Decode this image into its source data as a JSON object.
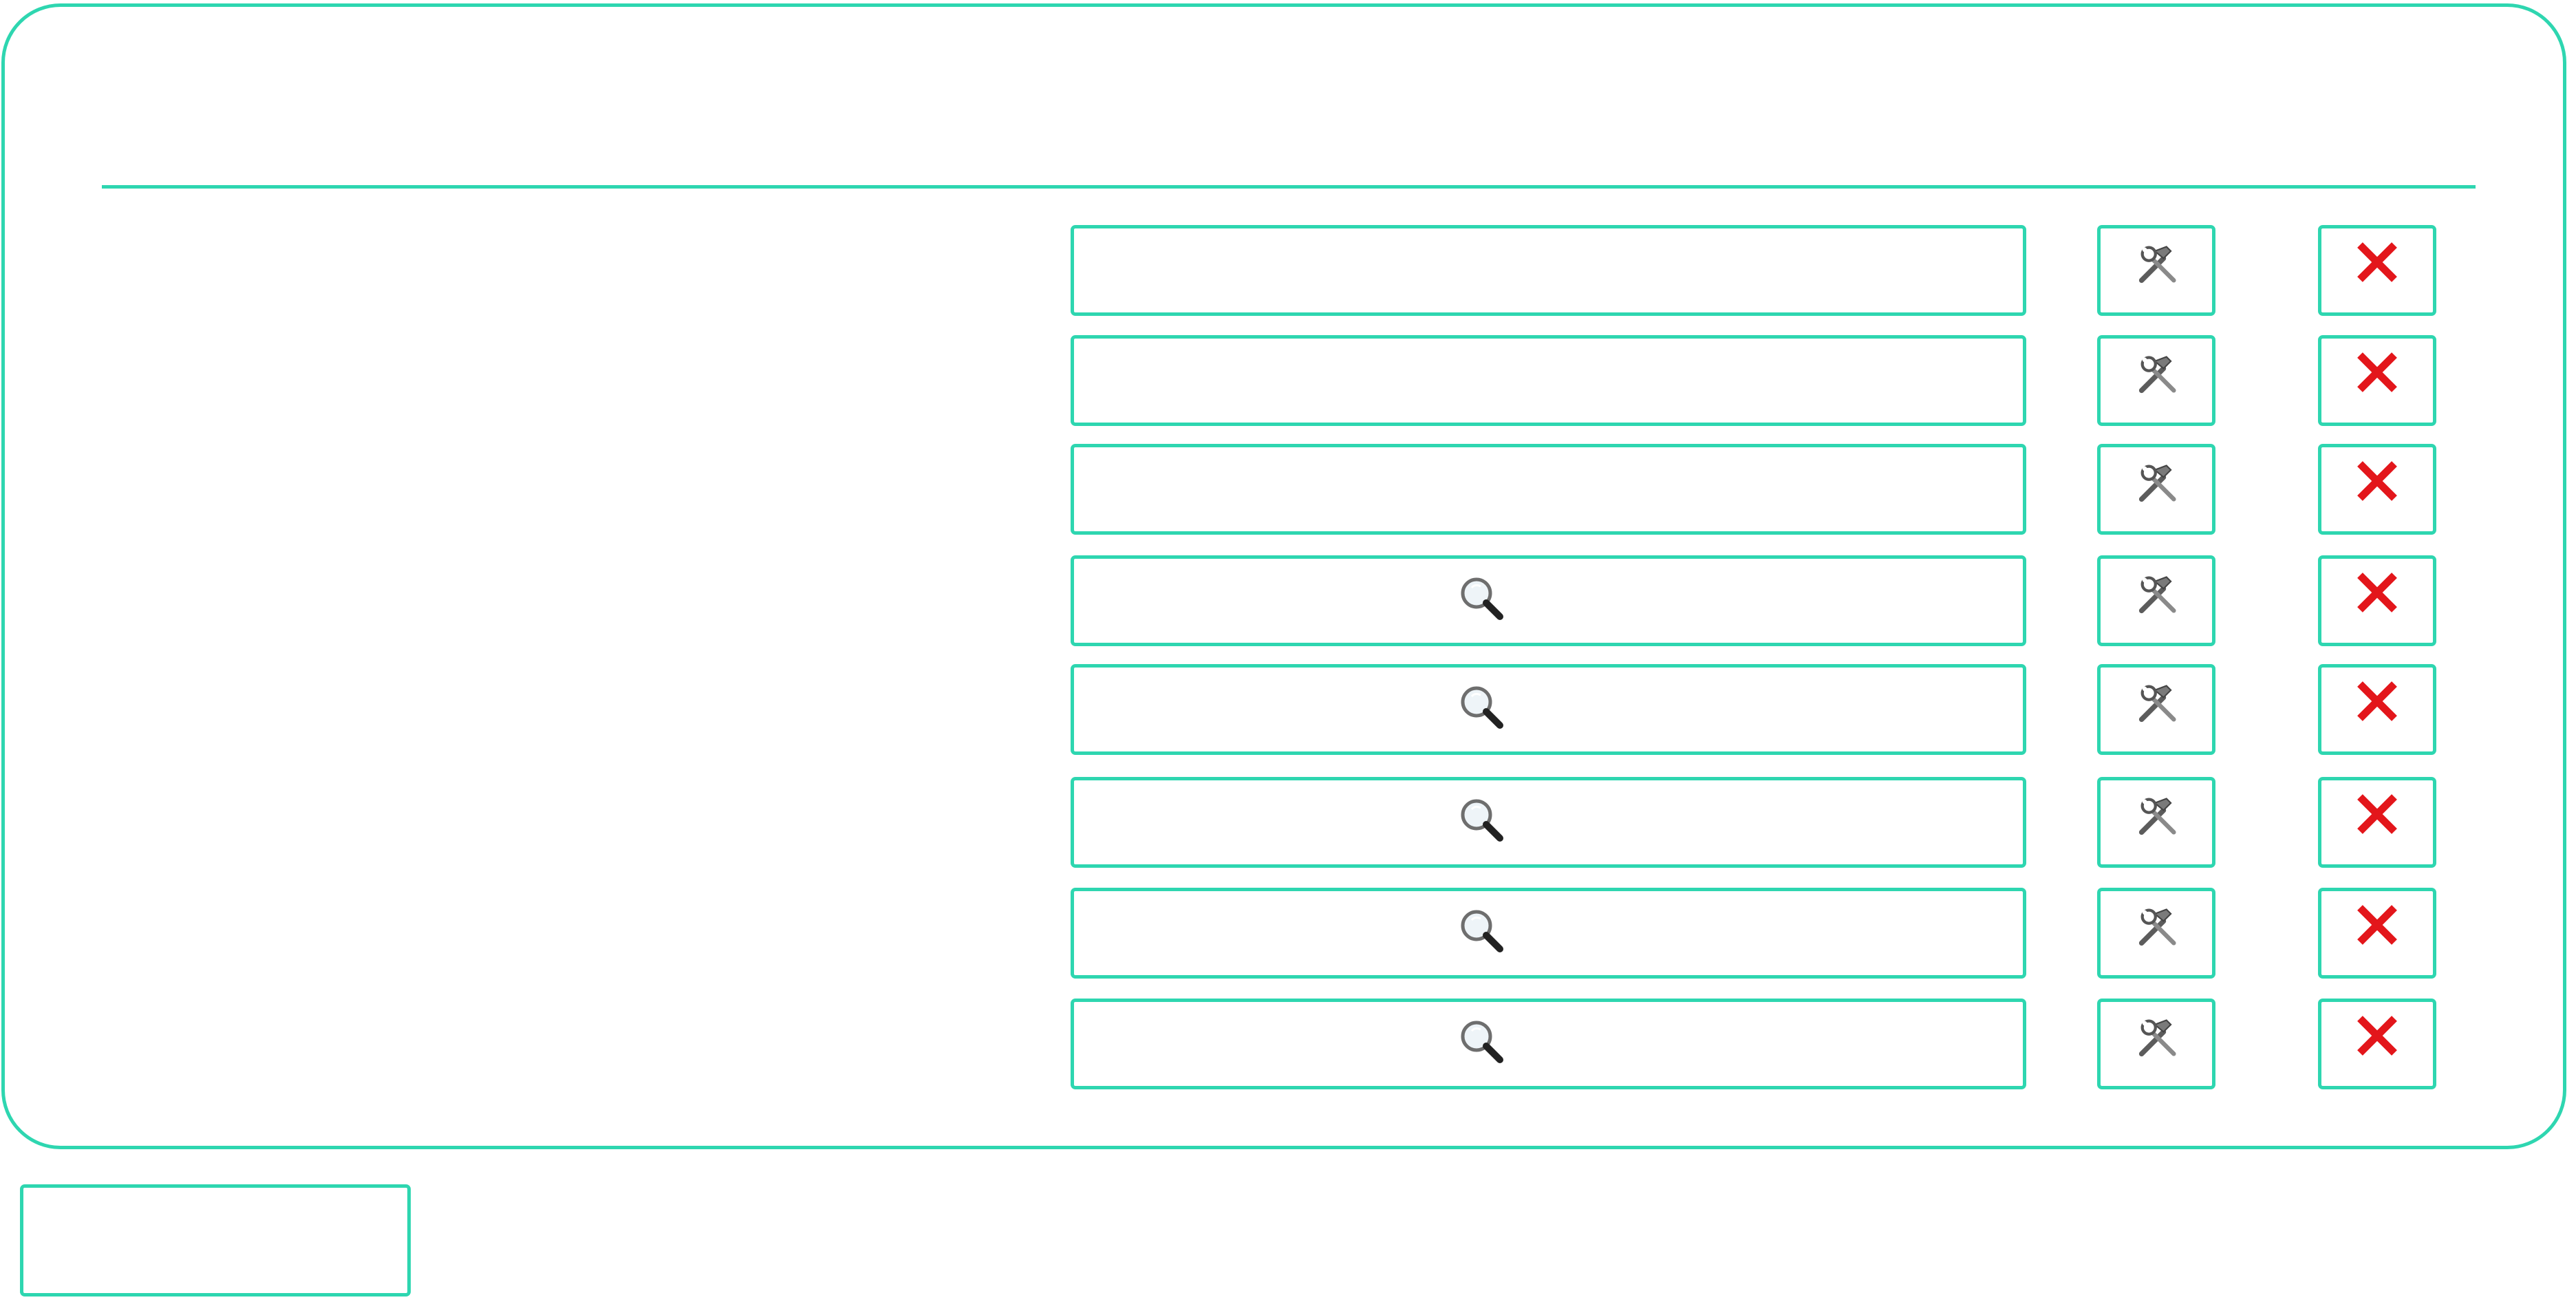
{
  "colors": {
    "accent_border": "#2ed6b0",
    "delete_red": "#e3161b",
    "tool_gray": "#6b6b6b"
  },
  "rows": [
    {
      "field_value": "",
      "has_search_icon": false,
      "tool_icon": "hammer-wrench-icon",
      "delete_icon": "red-x-icon"
    },
    {
      "field_value": "",
      "has_search_icon": false,
      "tool_icon": "hammer-wrench-icon",
      "delete_icon": "red-x-icon"
    },
    {
      "field_value": "",
      "has_search_icon": false,
      "tool_icon": "hammer-wrench-icon",
      "delete_icon": "red-x-icon"
    },
    {
      "field_value": "",
      "has_search_icon": true,
      "tool_icon": "hammer-wrench-icon",
      "delete_icon": "red-x-icon"
    },
    {
      "field_value": "",
      "has_search_icon": true,
      "tool_icon": "hammer-wrench-icon",
      "delete_icon": "red-x-icon"
    },
    {
      "field_value": "",
      "has_search_icon": true,
      "tool_icon": "hammer-wrench-icon",
      "delete_icon": "red-x-icon"
    },
    {
      "field_value": "",
      "has_search_icon": true,
      "tool_icon": "hammer-wrench-icon",
      "delete_icon": "red-x-icon"
    },
    {
      "field_value": "",
      "has_search_icon": true,
      "tool_icon": "hammer-wrench-icon",
      "delete_icon": "red-x-icon"
    }
  ],
  "bottom_button": {
    "label": ""
  }
}
